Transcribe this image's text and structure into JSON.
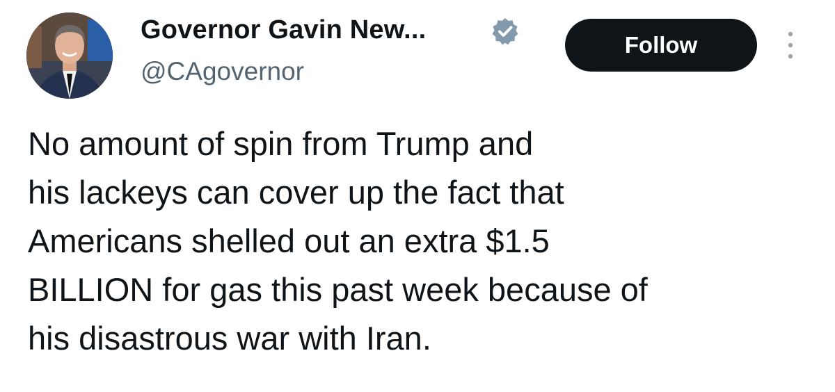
{
  "author": {
    "display_name": "Governor Gavin New...",
    "handle": "@CAgovernor",
    "avatar_icon": "profile-photo",
    "verified_icon": "verified-badge-icon",
    "verified_color": "#829aab"
  },
  "actions": {
    "follow_label": "Follow",
    "more_icon": "more-vertical-icon"
  },
  "tweet": {
    "lines": [
      "No amount of spin from Trump and",
      "his lackeys can cover up the fact that",
      "Americans shelled out an extra $1.5",
      "BILLION for gas this past week because of",
      "his disastrous war with Iran."
    ]
  },
  "colors": {
    "text": "#0f1419",
    "secondary_text": "#536471",
    "button_bg": "#0f1419",
    "button_text": "#ffffff"
  }
}
